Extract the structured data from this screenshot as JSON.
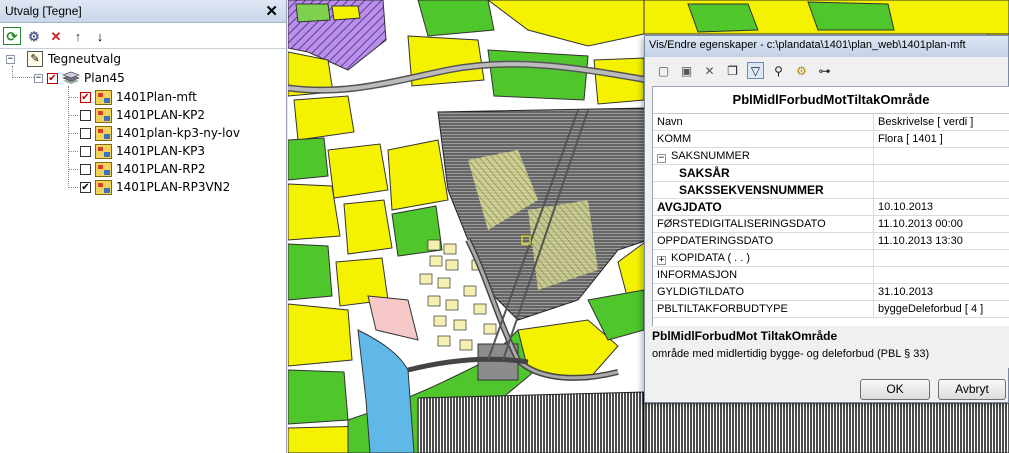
{
  "left_panel": {
    "title": "Utvalg [Tegne]",
    "close_glyph": "✕",
    "toolbar": [
      {
        "icon": "refresh-icon",
        "glyph": "⟳"
      },
      {
        "icon": "layer-settings-icon",
        "glyph": "⚙"
      },
      {
        "icon": "delete-icon",
        "glyph": "✕"
      },
      {
        "icon": "arrow-up-icon",
        "glyph": "↑"
      },
      {
        "icon": "arrow-down-icon",
        "glyph": "↓"
      }
    ],
    "tree": {
      "root_label": "Tegneutvalg",
      "group_label": "Plan45",
      "items": [
        {
          "label": "1401Plan-mft",
          "checked": true,
          "checkbox_color": "#c00000"
        },
        {
          "label": "1401PLAN-KP2",
          "checked": false
        },
        {
          "label": "1401plan-kp3-ny-lov",
          "checked": false
        },
        {
          "label": "1401PLAN-KP3",
          "checked": false
        },
        {
          "label": "1401PLAN-RP2",
          "checked": false
        },
        {
          "label": "1401PLAN-RP3VN2",
          "checked": true
        }
      ],
      "expander_minus": "−",
      "check_mark": "✔"
    }
  },
  "dialog": {
    "title": "Vis/Endre egenskaper - c:\\plandata\\1401\\plan_web\\1401plan-mft",
    "toolbar": [
      {
        "icon": "new-icon",
        "glyph": "▢"
      },
      {
        "icon": "save-icon",
        "glyph": "▣"
      },
      {
        "icon": "delete-icon",
        "glyph": "✕"
      },
      {
        "icon": "copy-icon",
        "glyph": "❐"
      },
      {
        "icon": "filter-icon",
        "glyph": "▽"
      },
      {
        "icon": "select-filter-icon",
        "glyph": "⚲"
      },
      {
        "icon": "settings-icon",
        "glyph": "⚙"
      },
      {
        "icon": "link-icon",
        "glyph": "⊶"
      }
    ],
    "heading": "PblMidlForbudMotTiltakOmråde",
    "columns": {
      "name": "Navn",
      "value": "Beskrivelse [ verdi ]"
    },
    "rows": [
      {
        "name": "KOMM",
        "value": "Flora [ 1401 ]",
        "style": "normal"
      },
      {
        "name": "SAKSNUMMER",
        "value": "",
        "style": "group-open"
      },
      {
        "name": "SAKSÅR",
        "value": "",
        "style": "bold-indent"
      },
      {
        "name": "SAKSSEKVENSNUMMER",
        "value": "",
        "style": "bold-indent"
      },
      {
        "name": "AVGJDATO",
        "value": "10.10.2013",
        "style": "bold"
      },
      {
        "name": "FØRSTEDIGITALISERINGSDATO",
        "value": "11.10.2013 00:00",
        "style": "normal"
      },
      {
        "name": "OPPDATERINGSDATO",
        "value": "11.10.2013 13:30",
        "style": "normal"
      },
      {
        "name": "KOPIDATA ( . . )",
        "value": "",
        "style": "group-closed"
      },
      {
        "name": "INFORMASJON",
        "value": "",
        "style": "normal"
      },
      {
        "name": "GYLDIGTILDATO",
        "value": "31.10.2013",
        "style": "normal"
      },
      {
        "name": "PBLTILTAKFORBUDTYPE",
        "value": "byggeDeleforbud [ 4 ]",
        "style": "normal"
      }
    ],
    "description": {
      "title": "PblMidlForbudMot TiltakOmråde",
      "text": "område med midlertidig bygge- og deleforbud (PBL § 33)"
    },
    "buttons": {
      "ok": "OK",
      "cancel": "Avbryt"
    },
    "plus": "+",
    "minus": "−"
  },
  "colors": {
    "map_background": "#ffffff",
    "zone_yellow": "#f5f200",
    "zone_green": "#4fc62c",
    "zone_gray": "#7a7a7a",
    "zone_purple": "#9a6bd8",
    "water_blue": "#5fb8e8",
    "road_gray": "#8c8c8c"
  }
}
